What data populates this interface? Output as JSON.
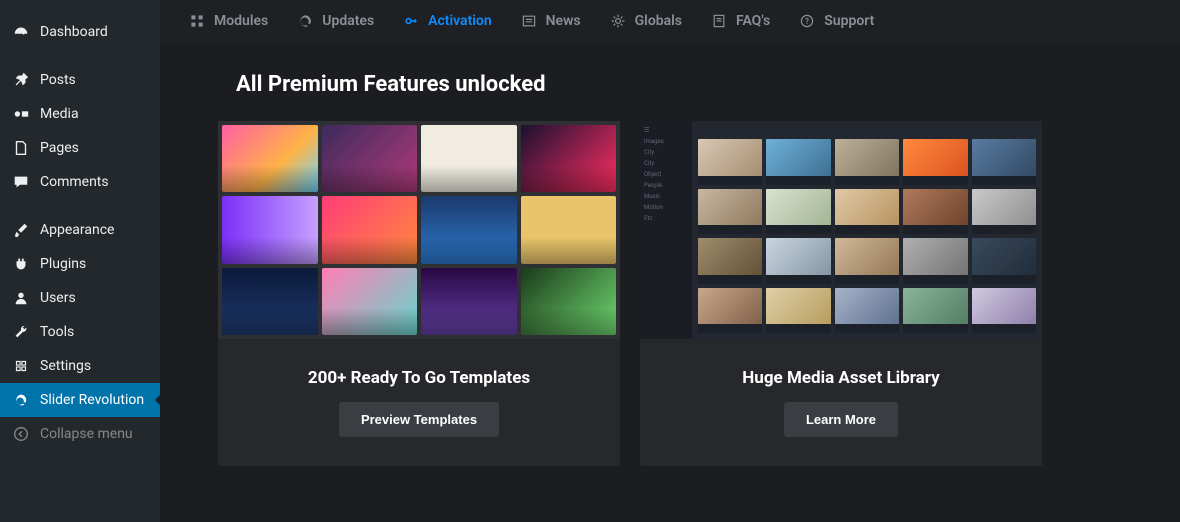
{
  "sidebar": {
    "items": [
      {
        "label": "Dashboard",
        "icon": "dashboard"
      },
      {
        "label": "Posts",
        "icon": "pin"
      },
      {
        "label": "Media",
        "icon": "media"
      },
      {
        "label": "Pages",
        "icon": "pages"
      },
      {
        "label": "Comments",
        "icon": "comments"
      },
      {
        "label": "Appearance",
        "icon": "brush"
      },
      {
        "label": "Plugins",
        "icon": "plug"
      },
      {
        "label": "Users",
        "icon": "user"
      },
      {
        "label": "Tools",
        "icon": "wrench"
      },
      {
        "label": "Settings",
        "icon": "settings"
      },
      {
        "label": "Slider Revolution",
        "icon": "refresh"
      }
    ],
    "collapse_label": "Collapse menu"
  },
  "topnav": {
    "items": [
      {
        "label": "Modules",
        "icon": "grid"
      },
      {
        "label": "Updates",
        "icon": "update"
      },
      {
        "label": "Activation",
        "icon": "key",
        "active": true
      },
      {
        "label": "News",
        "icon": "news"
      },
      {
        "label": "Globals",
        "icon": "gear"
      },
      {
        "label": "FAQ's",
        "icon": "faq"
      },
      {
        "label": "Support",
        "icon": "help"
      }
    ]
  },
  "page": {
    "title": "All Premium Features unlocked",
    "cards": [
      {
        "title": "200+ Ready To Go Templates",
        "button": "Preview Templates"
      },
      {
        "title": "Huge Media Asset Library",
        "button": "Learn More"
      }
    ]
  }
}
